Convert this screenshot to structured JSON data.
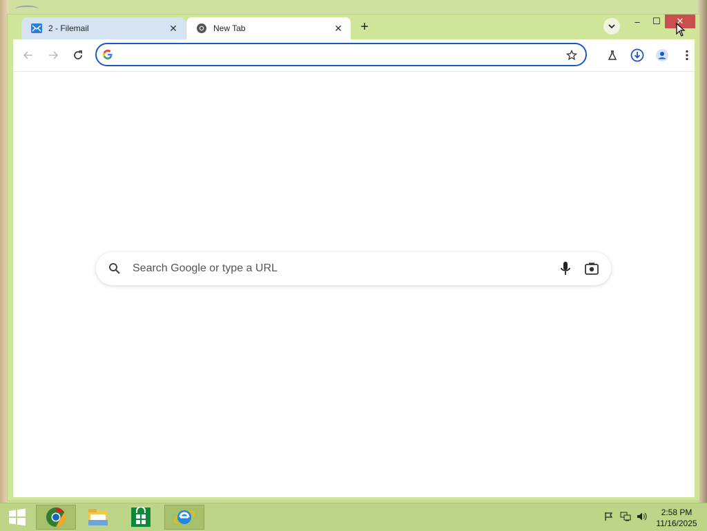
{
  "tabs": [
    {
      "title": "2 - Filemail",
      "favicon": "filemail-icon",
      "active": false
    },
    {
      "title": "New Tab",
      "favicon": "chrome-icon",
      "active": true
    }
  ],
  "window_controls": {
    "minimize": "–",
    "maximize": "☐",
    "close": "✕"
  },
  "toolbar": {
    "omnibox_value": "",
    "icons": [
      "back-arrow-icon",
      "forward-arrow-icon",
      "reload-icon",
      "star-icon",
      "labs-flask-icon",
      "download-icon",
      "profile-icon",
      "menu-kebab-icon"
    ]
  },
  "ntp": {
    "search_placeholder": "Search Google or type a URL"
  },
  "taskbar": {
    "items": [
      "windows-start-icon",
      "chrome-icon",
      "file-explorer-icon",
      "store-icon",
      "internet-explorer-icon"
    ],
    "time": "2:58 PM",
    "date": "11/16/2025"
  },
  "colors": {
    "window_frame": "#cfe59a",
    "omnibox_border": "#1a56c4",
    "close_button": "#c94f4f",
    "taskbar": "#bcd587"
  }
}
